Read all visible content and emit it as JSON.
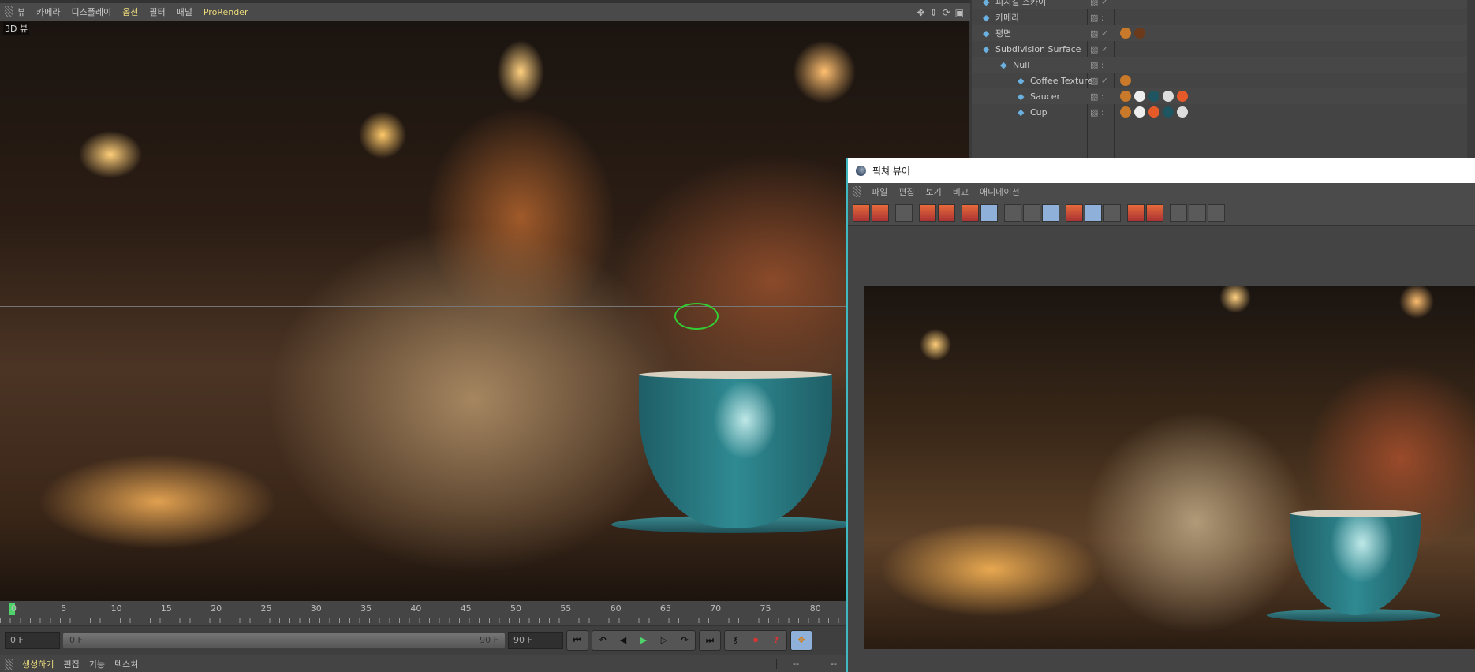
{
  "viewport_menu": {
    "items": [
      "뷰",
      "카메라",
      "디스플레이",
      "옵션",
      "필터",
      "패널",
      "ProRender"
    ],
    "view_label": "3D 뷰"
  },
  "object_manager": {
    "objects": [
      {
        "name": "피지컬 스카이",
        "level": 0
      },
      {
        "name": "카메라",
        "level": 0
      },
      {
        "name": "평면",
        "level": 0
      },
      {
        "name": "Subdivision Surface",
        "level": 0
      },
      {
        "name": "Null",
        "level": 1
      },
      {
        "name": "Coffee Texture",
        "level": 2
      },
      {
        "name": "Saucer",
        "level": 2
      },
      {
        "name": "Cup",
        "level": 2
      }
    ]
  },
  "timeline": {
    "ticks": [
      "0",
      "5",
      "10",
      "15",
      "20",
      "25",
      "30",
      "35",
      "40",
      "45",
      "50",
      "55",
      "60",
      "65",
      "70",
      "75",
      "80"
    ],
    "current_frame": "0 F",
    "range_start": "0 F",
    "range_end": "90 F",
    "end_frame": "90 F"
  },
  "bottom_panel": {
    "tabs": [
      "생성하기",
      "편집",
      "기능",
      "텍스쳐"
    ],
    "side": [
      "--",
      "--"
    ]
  },
  "picture_viewer": {
    "title": "픽쳐 뷰어",
    "menu": [
      "파일",
      "편집",
      "보기",
      "비교",
      "애니메이션"
    ]
  },
  "colors": {
    "accent": "#3fb8c0",
    "playhead": "#4dd36a",
    "menu_highlight": "#e8d87a",
    "cup": "#2f8a92"
  }
}
